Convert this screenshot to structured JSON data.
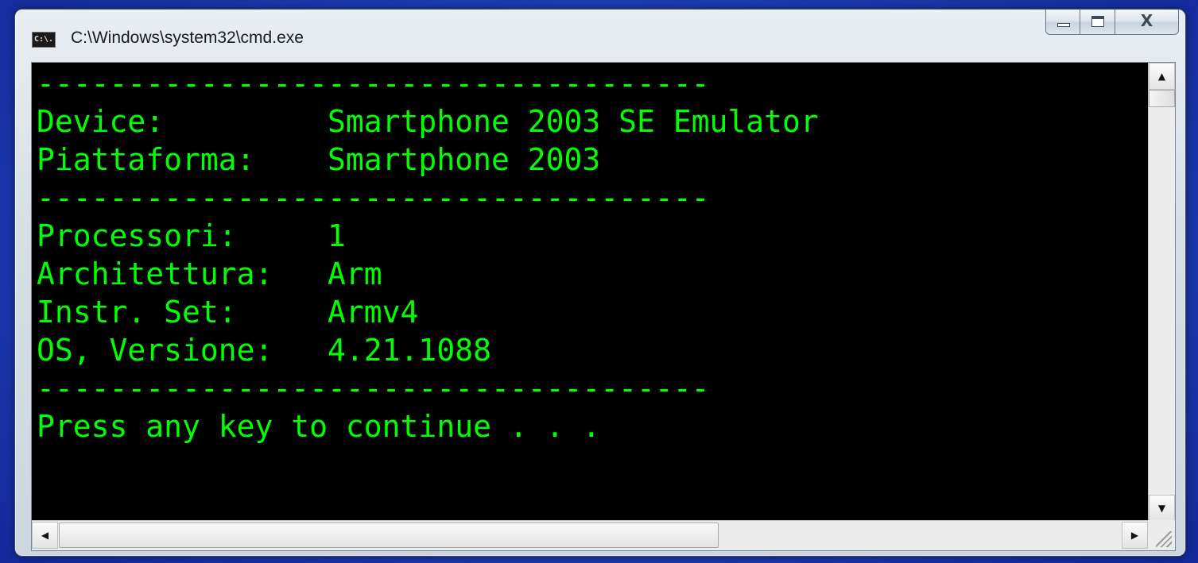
{
  "window": {
    "title": "C:\\Windows\\system32\\cmd.exe",
    "app_icon_text": "C:\\.",
    "controls": {
      "minimize_icon": "minimize-icon",
      "maximize_icon": "maximize-icon",
      "close_label": "X"
    }
  },
  "console": {
    "text_color": "#00ff00",
    "background": "#000000",
    "lines": [
      "-------------------------------------",
      "Device:         Smartphone 2003 SE Emulator",
      "Piattaforma:    Smartphone 2003",
      "-------------------------------------",
      "Processori:     1",
      "Architettura:   Arm",
      "Instr. Set:     Armv4",
      "OS, Versione:   4.21.1088",
      "-------------------------------------",
      "Press any key to continue . . ."
    ]
  },
  "scrollbars": {
    "up_arrow": "▲",
    "down_arrow": "▼",
    "left_arrow": "◀",
    "right_arrow": "▶"
  }
}
